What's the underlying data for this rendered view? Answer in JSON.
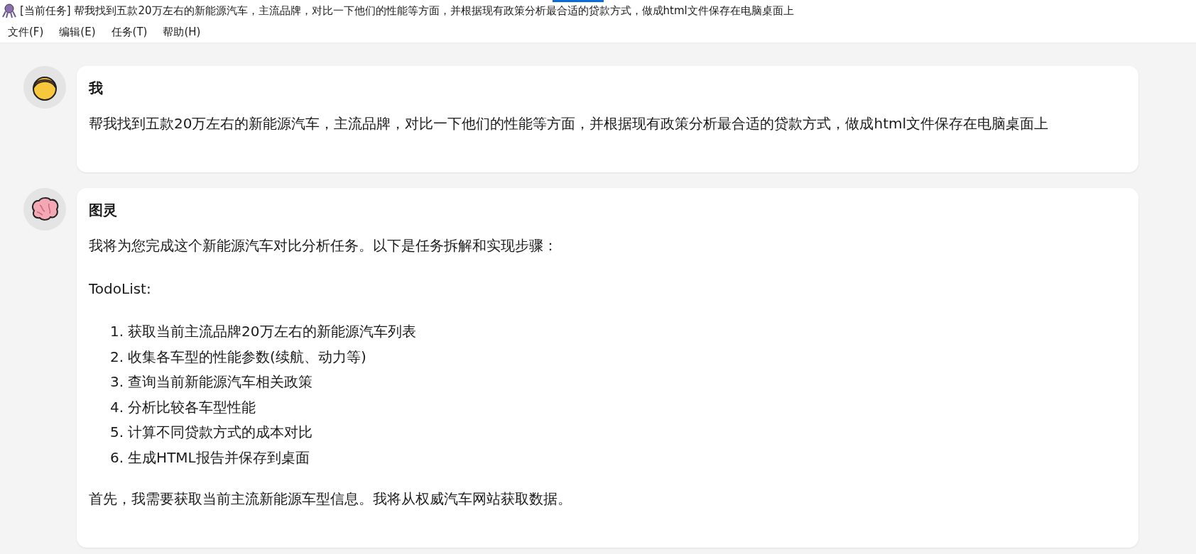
{
  "window": {
    "title": "[当前任务] 帮我找到五款20万左右的新能源汽车，主流品牌，对比一下他们的性能等方面，并根据现有政策分析最合适的贷款方式，做成html文件保存在电脑桌面上"
  },
  "menu": [
    "文件(F)",
    "编辑(E)",
    "任务(T)",
    "帮助(H)"
  ],
  "messages": [
    {
      "kind": "user",
      "sender": "我",
      "blocks": [
        {
          "kind": "paragraph",
          "text": "帮我找到五款20万左右的新能源汽车，主流品牌，对比一下他们的性能等方面，并根据现有政策分析最合适的贷款方式，做成html文件保存在电脑桌面上"
        }
      ]
    },
    {
      "kind": "assistant",
      "sender": "图灵",
      "blocks": [
        {
          "kind": "paragraph",
          "text": "我将为您完成这个新能源汽车对比分析任务。以下是任务拆解和实现步骤："
        },
        {
          "kind": "paragraph",
          "text": "TodoList:"
        },
        {
          "kind": "list",
          "items": [
            {
              "number": "1.",
              "text": "获取当前主流品牌20万左右的新能源汽车列表"
            },
            {
              "number": "2.",
              "text": "收集各车型的性能参数(续航、动力等)"
            },
            {
              "number": "3.",
              "text": "查询当前新能源汽车相关政策"
            },
            {
              "number": "4.",
              "text": "分析比较各车型性能"
            },
            {
              "number": "5.",
              "text": "计算不同贷款方式的成本对比"
            },
            {
              "number": "6.",
              "text": "生成HTML报告并保存到桌面"
            }
          ]
        },
        {
          "kind": "paragraph",
          "text": "首先，我需要获取当前主流新能源车型信息。我将从权威汽车网站获取数据。"
        }
      ]
    }
  ]
}
